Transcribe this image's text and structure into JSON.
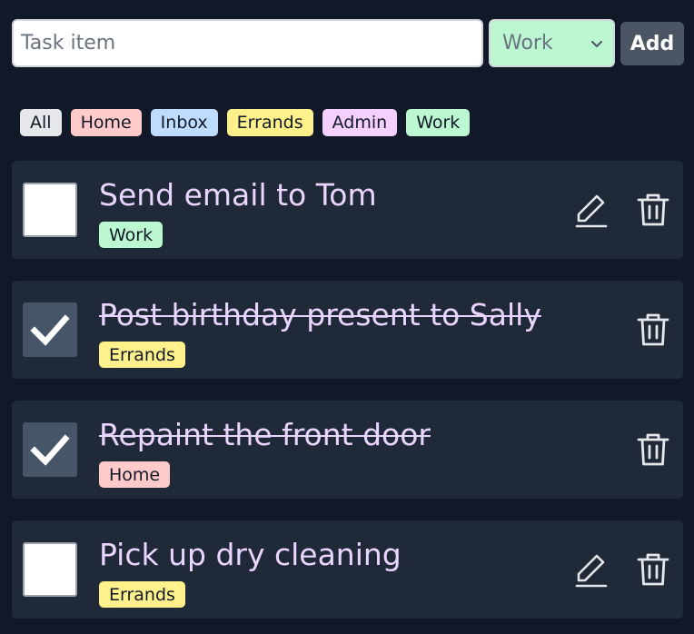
{
  "form": {
    "task_placeholder": "Task item",
    "task_value": "",
    "category_selected": "Work",
    "add_label": "Add"
  },
  "filters": [
    {
      "label": "All",
      "color": "#e5e7eb"
    },
    {
      "label": "Home",
      "color": "#fecaca"
    },
    {
      "label": "Inbox",
      "color": "#bfdbfe"
    },
    {
      "label": "Errands",
      "color": "#fef08a"
    },
    {
      "label": "Admin",
      "color": "#f5d0fe"
    },
    {
      "label": "Work",
      "color": "#bbf7d0"
    }
  ],
  "tasks": [
    {
      "title": "Send email to Tom",
      "category": "Work",
      "category_color": "#bbf7d0",
      "completed": false,
      "editable": true
    },
    {
      "title": "Post birthday present to Sally",
      "category": "Errands",
      "category_color": "#fef08a",
      "completed": true,
      "editable": false
    },
    {
      "title": "Repaint the front door",
      "category": "Home",
      "category_color": "#fecaca",
      "completed": true,
      "editable": false
    },
    {
      "title": "Pick up dry cleaning",
      "category": "Errands",
      "category_color": "#fef08a",
      "completed": false,
      "editable": true
    }
  ],
  "icons": {
    "edit": "pencil-icon",
    "delete": "trash-icon",
    "checked": "check-icon",
    "select": "chevron-down-icon"
  },
  "colors": {
    "background": "#111827",
    "card": "#1f2937",
    "title_text": "#e9d5ff",
    "icon": "#e5e7eb",
    "add_button": "#4b5563",
    "checked_box": "#475569"
  }
}
